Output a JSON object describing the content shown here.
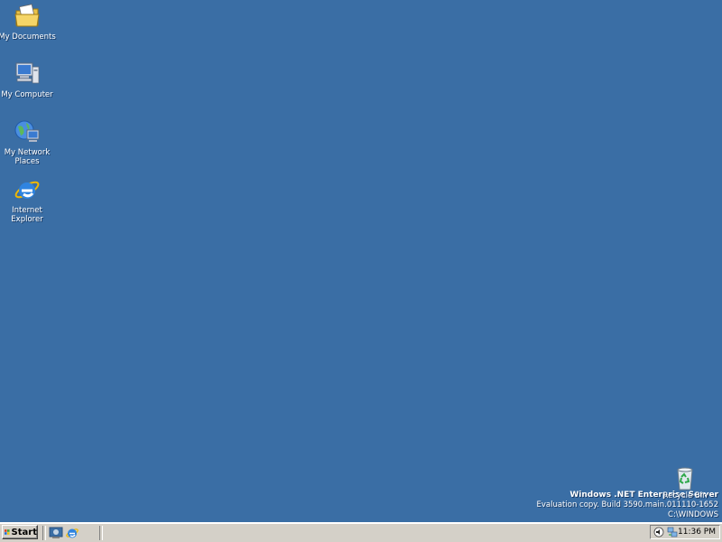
{
  "desktop": {
    "background_color": "#3a6ea5",
    "icons": [
      {
        "label": "My Documents",
        "icon": "folder-documents-icon"
      },
      {
        "label": "My Computer",
        "icon": "computer-icon"
      },
      {
        "label": "My Network Places",
        "icon": "network-places-icon"
      },
      {
        "label": "Internet Explorer",
        "icon": "internet-explorer-icon"
      },
      {
        "label": "Recycle Bin",
        "icon": "recycle-bin-icon"
      }
    ],
    "watermark": {
      "title": "Windows .NET Enterprise Server",
      "build": "Evaluation copy. Build 3590.main.011110-1652",
      "path": "C:\\WINDOWS"
    }
  },
  "taskbar": {
    "start_label": "Start",
    "quick_launch": [
      {
        "name": "Show Desktop",
        "icon": "show-desktop-icon"
      },
      {
        "name": "Internet Explorer",
        "icon": "internet-explorer-icon"
      }
    ],
    "tray": {
      "icons": [
        "speaker-icon",
        "network-status-icon"
      ],
      "clock": "11:36 PM"
    }
  }
}
